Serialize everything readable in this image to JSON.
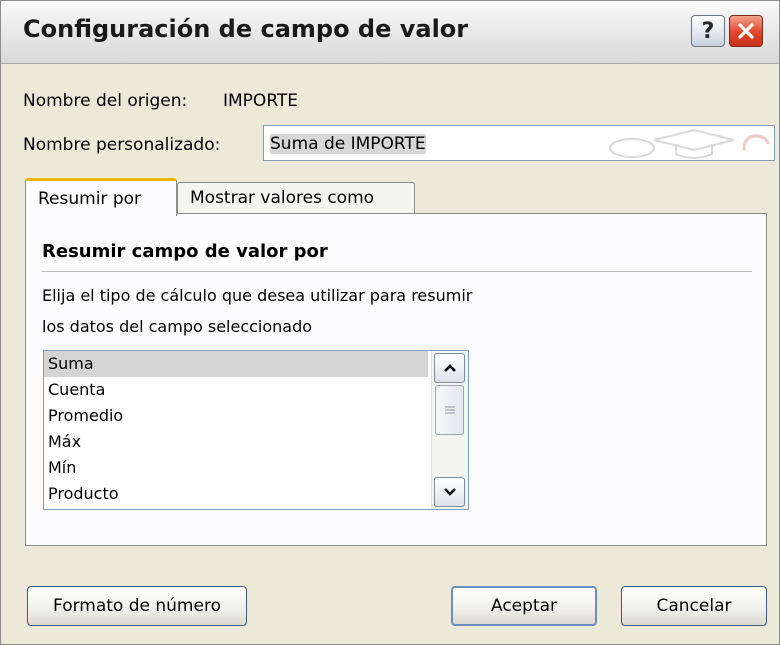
{
  "dialog": {
    "title": "Configuración de campo de valor",
    "help_glyph": "?",
    "close_icon": "close-icon"
  },
  "source": {
    "label": "Nombre del origen:",
    "value": "IMPORTE"
  },
  "custom_name": {
    "label": "Nombre personalizado:",
    "value": "Suma de IMPORTE"
  },
  "tabs": [
    {
      "label": "Resumir por",
      "active": true
    },
    {
      "label": "Mostrar valores como",
      "active": false
    }
  ],
  "summarize": {
    "section_title": "Resumir campo de valor por",
    "description_line1": "Elija el tipo de cálculo que desea utilizar para resumir",
    "description_line2": "los datos del campo seleccionado",
    "options": [
      "Suma",
      "Cuenta",
      "Promedio",
      "Máx",
      "Mín",
      "Producto"
    ],
    "selected": "Suma"
  },
  "buttons": {
    "number_format": "Formato de número",
    "accept": "Aceptar",
    "cancel": "Cancelar"
  },
  "colors": {
    "dialog_bg": "#ece9d8",
    "tab_accent": "#f4b400",
    "close_button": "#e0462a",
    "selection": "#d4d4d4"
  }
}
